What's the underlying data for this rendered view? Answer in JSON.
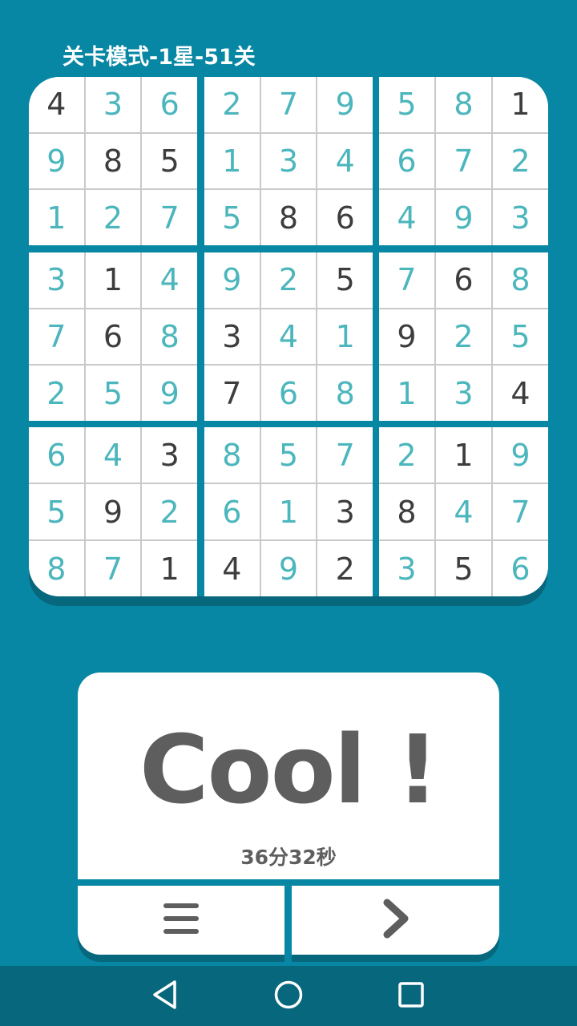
{
  "header": {
    "level_title": "关卡模式-1星-51关"
  },
  "board": {
    "rows": [
      [
        "4",
        "3",
        "6",
        "2",
        "7",
        "9",
        "5",
        "8",
        "1"
      ],
      [
        "9",
        "8",
        "5",
        "1",
        "3",
        "4",
        "6",
        "7",
        "2"
      ],
      [
        "1",
        "2",
        "7",
        "5",
        "8",
        "6",
        "4",
        "9",
        "3"
      ],
      [
        "3",
        "1",
        "4",
        "9",
        "2",
        "5",
        "7",
        "6",
        "8"
      ],
      [
        "7",
        "6",
        "8",
        "3",
        "4",
        "1",
        "9",
        "2",
        "5"
      ],
      [
        "2",
        "5",
        "9",
        "7",
        "6",
        "8",
        "1",
        "3",
        "4"
      ],
      [
        "6",
        "4",
        "3",
        "8",
        "5",
        "7",
        "2",
        "1",
        "9"
      ],
      [
        "5",
        "9",
        "2",
        "6",
        "1",
        "3",
        "8",
        "4",
        "7"
      ],
      [
        "8",
        "7",
        "1",
        "4",
        "9",
        "2",
        "3",
        "5",
        "6"
      ]
    ],
    "given": [
      [
        1,
        0,
        0,
        0,
        0,
        0,
        0,
        0,
        1
      ],
      [
        0,
        1,
        1,
        0,
        0,
        0,
        0,
        0,
        0
      ],
      [
        0,
        0,
        0,
        0,
        1,
        1,
        0,
        0,
        0
      ],
      [
        0,
        1,
        0,
        0,
        0,
        1,
        0,
        1,
        0
      ],
      [
        0,
        1,
        0,
        1,
        0,
        0,
        1,
        0,
        0
      ],
      [
        0,
        0,
        0,
        1,
        0,
        0,
        0,
        0,
        1
      ],
      [
        0,
        0,
        1,
        0,
        0,
        0,
        0,
        1,
        0
      ],
      [
        0,
        1,
        0,
        0,
        0,
        1,
        1,
        0,
        0
      ],
      [
        0,
        0,
        1,
        1,
        0,
        1,
        0,
        1,
        0
      ]
    ],
    "colors": {
      "given": "#3d3d3d",
      "filled": "#4cb6bd"
    }
  },
  "result": {
    "message": "Cool !",
    "time": "36分32秒"
  },
  "actions": {
    "menu_icon": "menu-icon",
    "next_icon": "chevron-right-icon"
  },
  "navigation": {
    "back_icon": "back-triangle-icon",
    "home_icon": "home-circle-icon",
    "recents_icon": "recents-square-icon"
  },
  "colors": {
    "background": "#0787a3",
    "shadow": "#06677d",
    "text_dark": "#5e5e5e"
  }
}
